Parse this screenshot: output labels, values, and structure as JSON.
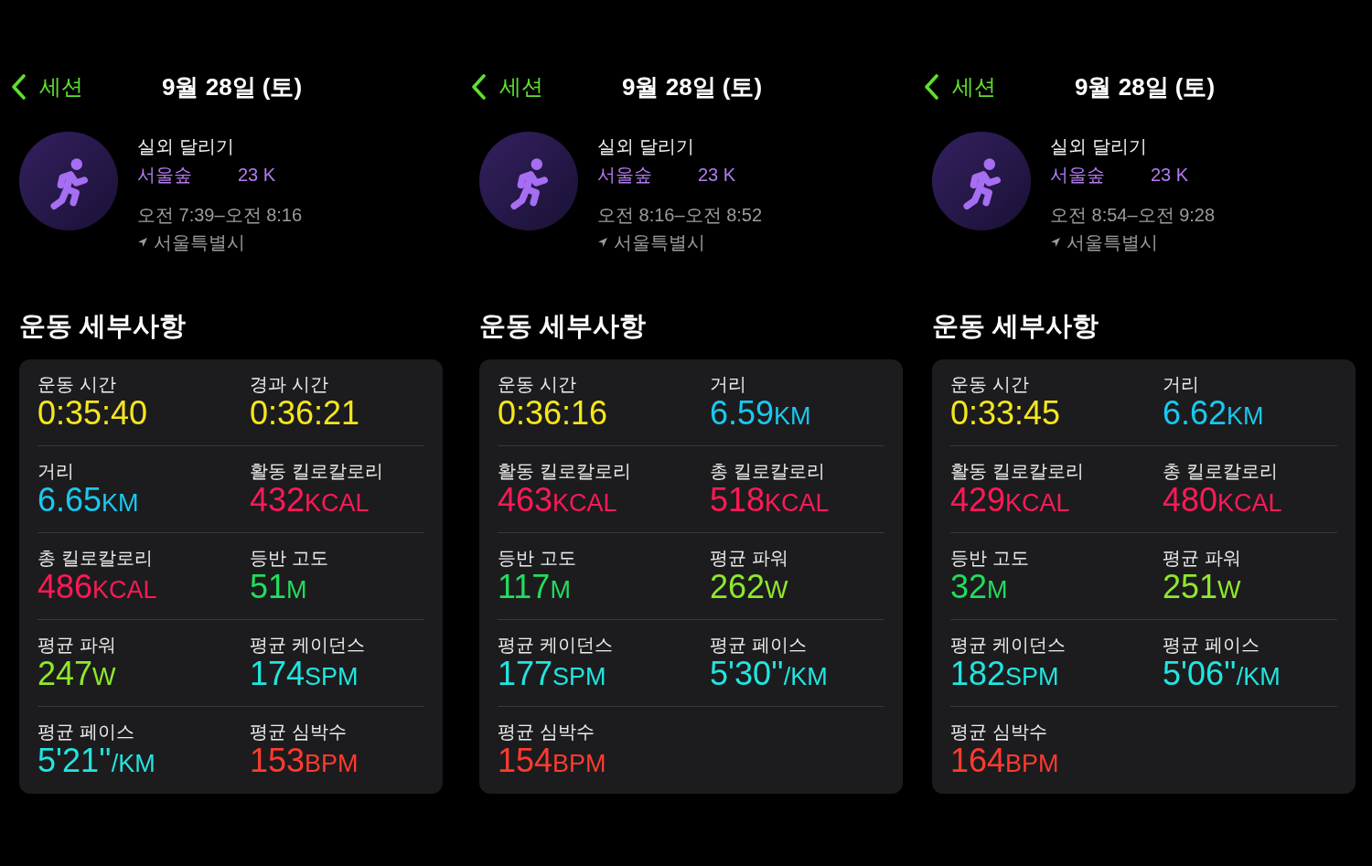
{
  "sessions": [
    {
      "nav": {
        "back": "세션",
        "title": "9월 28일 (토)"
      },
      "workout": {
        "name": "실외 달리기",
        "tag": "서울숲",
        "tag_detail": "23 K",
        "time_range": "오전 7:39–오전 8:16",
        "place": "서울특별시"
      },
      "section_title": "운동 세부사항",
      "metrics": [
        {
          "label": "운동 시간",
          "value": "0:35:40",
          "color": "#f5e61d"
        },
        {
          "label": "경과 시간",
          "value": "0:36:21",
          "color": "#f5e61d"
        },
        {
          "label": "거리",
          "value": "6.65",
          "unit": "KM",
          "color": "#1ac8f0"
        },
        {
          "label": "활동 킬로칼로리",
          "value": "432",
          "unit": "KCAL",
          "color": "#ff1a56"
        },
        {
          "label": "총 킬로칼로리",
          "value": "486",
          "unit": "KCAL",
          "color": "#ff1a56"
        },
        {
          "label": "등반 고도",
          "value": "51",
          "unit": "M",
          "color": "#22dd5c"
        },
        {
          "label": "평균 파워",
          "value": "247",
          "unit": "W",
          "color": "#8fe82c"
        },
        {
          "label": "평균 케이던스",
          "value": "174",
          "unit": "SPM",
          "color": "#21e5e0"
        },
        {
          "label": "평균 페이스",
          "value": "5'21''",
          "unit": "/KM",
          "color": "#21e5e0"
        },
        {
          "label": "평균 심박수",
          "value": "153",
          "unit": "BPM",
          "color": "#ff3b30"
        }
      ]
    },
    {
      "nav": {
        "back": "세션",
        "title": "9월 28일 (토)"
      },
      "workout": {
        "name": "실외 달리기",
        "tag": "서울숲",
        "tag_detail": "23 K",
        "time_range": "오전 8:16–오전 8:52",
        "place": "서울특별시"
      },
      "section_title": "운동 세부사항",
      "metrics": [
        {
          "label": "운동 시간",
          "value": "0:36:16",
          "color": "#f5e61d"
        },
        {
          "label": "거리",
          "value": "6.59",
          "unit": "KM",
          "color": "#1ac8f0"
        },
        {
          "label": "활동 킬로칼로리",
          "value": "463",
          "unit": "KCAL",
          "color": "#ff1a56"
        },
        {
          "label": "총 킬로칼로리",
          "value": "518",
          "unit": "KCAL",
          "color": "#ff1a56"
        },
        {
          "label": "등반 고도",
          "value": "117",
          "unit": "M",
          "color": "#22dd5c"
        },
        {
          "label": "평균 파워",
          "value": "262",
          "unit": "W",
          "color": "#8fe82c"
        },
        {
          "label": "평균 케이던스",
          "value": "177",
          "unit": "SPM",
          "color": "#21e5e0"
        },
        {
          "label": "평균 페이스",
          "value": "5'30''",
          "unit": "/KM",
          "color": "#21e5e0"
        },
        {
          "label": "평균 심박수",
          "value": "154",
          "unit": "BPM",
          "color": "#ff3b30"
        }
      ]
    },
    {
      "nav": {
        "back": "세션",
        "title": "9월 28일 (토)"
      },
      "workout": {
        "name": "실외 달리기",
        "tag": "서울숲",
        "tag_detail": "23 K",
        "time_range": "오전 8:54–오전 9:28",
        "place": "서울특별시"
      },
      "section_title": "운동 세부사항",
      "metrics": [
        {
          "label": "운동 시간",
          "value": "0:33:45",
          "color": "#f5e61d"
        },
        {
          "label": "거리",
          "value": "6.62",
          "unit": "KM",
          "color": "#1ac8f0"
        },
        {
          "label": "활동 킬로칼로리",
          "value": "429",
          "unit": "KCAL",
          "color": "#ff1a56"
        },
        {
          "label": "총 킬로칼로리",
          "value": "480",
          "unit": "KCAL",
          "color": "#ff1a56"
        },
        {
          "label": "등반 고도",
          "value": "32",
          "unit": "M",
          "color": "#22dd5c"
        },
        {
          "label": "평균 파워",
          "value": "251",
          "unit": "W",
          "color": "#8fe82c"
        },
        {
          "label": "평균 케이던스",
          "value": "182",
          "unit": "SPM",
          "color": "#21e5e0"
        },
        {
          "label": "평균 페이스",
          "value": "5'06''",
          "unit": "/KM",
          "color": "#21e5e0"
        },
        {
          "label": "평균 심박수",
          "value": "164",
          "unit": "BPM",
          "color": "#ff3b30"
        }
      ]
    }
  ]
}
